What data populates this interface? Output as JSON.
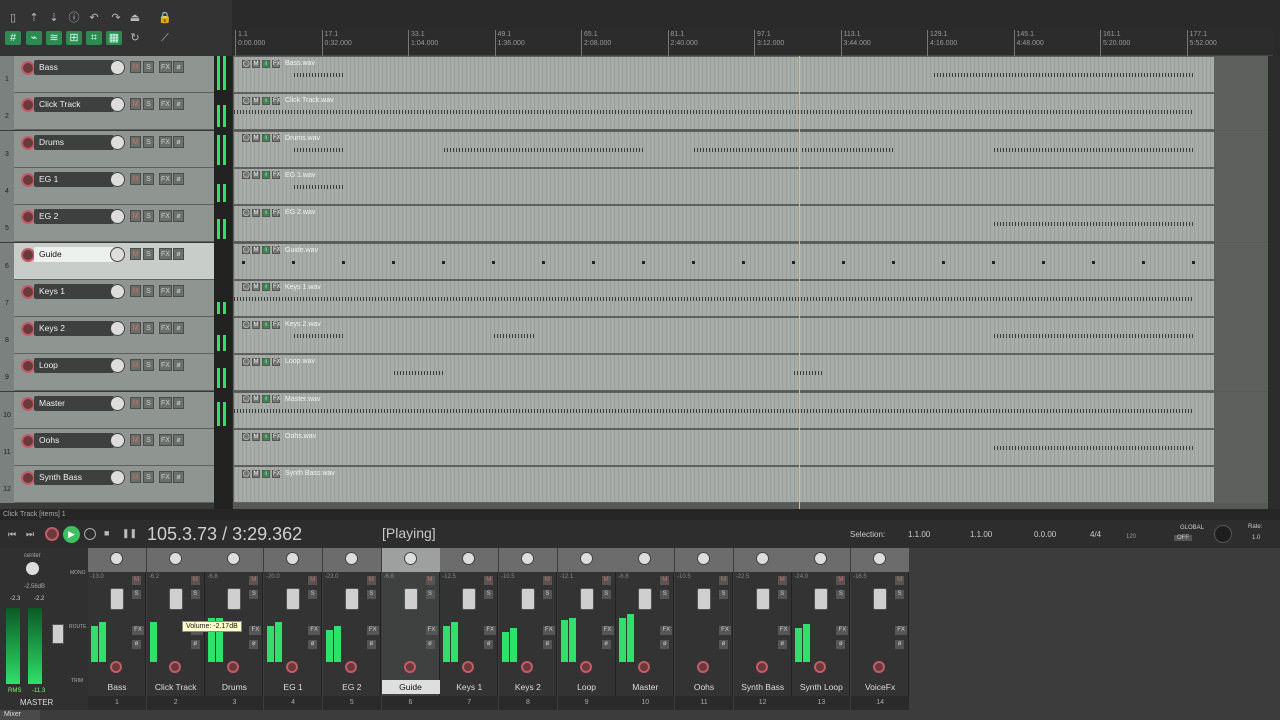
{
  "toolbar": {
    "icons": [
      "new-project-icon",
      "open-icon",
      "save-icon",
      "info-icon",
      "undo-icon",
      "redo-icon",
      "metronome-icon",
      "grid-icon",
      "snap-icon",
      "ripple-icon",
      "group-icon",
      "trim-icon",
      "grid-toggle-icon",
      "loop-icon",
      "lock-icon",
      "envelope-icon"
    ]
  },
  "ruler": {
    "marks": [
      {
        "bar": "1.1",
        "time": "0:00.000"
      },
      {
        "bar": "17.1",
        "time": "0:32.000"
      },
      {
        "bar": "33.1",
        "time": "1:04.000"
      },
      {
        "bar": "49.1",
        "time": "1:36.000"
      },
      {
        "bar": "65.1",
        "time": "2:08.000"
      },
      {
        "bar": "81.1",
        "time": "2:40.000"
      },
      {
        "bar": "97.1",
        "time": "3:12.000"
      },
      {
        "bar": "113.1",
        "time": "3:44.000"
      },
      {
        "bar": "129.1",
        "time": "4:16.000"
      },
      {
        "bar": "145.1",
        "time": "4:48.000"
      },
      {
        "bar": "161.1",
        "time": "5:20.000"
      },
      {
        "bar": "177.1",
        "time": "5:52.000"
      }
    ]
  },
  "tracks": [
    {
      "num": "1",
      "name": "Bass",
      "item": "Bass.wav"
    },
    {
      "num": "2",
      "name": "Click Track",
      "item": "Click Track.wav"
    },
    {
      "num": "3",
      "name": "Drums",
      "item": "Drums.wav"
    },
    {
      "num": "4",
      "name": "EG 1",
      "item": "EG 1.wav"
    },
    {
      "num": "5",
      "name": "EG 2",
      "item": "EG 2.wav"
    },
    {
      "num": "6",
      "name": "Guide",
      "item": "Guide.wav"
    },
    {
      "num": "7",
      "name": "Keys 1",
      "item": "Keys 1.wav"
    },
    {
      "num": "8",
      "name": "Keys 2",
      "item": "Keys 2.wav"
    },
    {
      "num": "9",
      "name": "Loop",
      "item": "Loop.wav"
    },
    {
      "num": "10",
      "name": "Master",
      "item": "Master.wav"
    },
    {
      "num": "11",
      "name": "Oohs",
      "item": "Oohs.wav"
    },
    {
      "num": "12",
      "name": "Synth Bass",
      "item": "Synth Bass.wav"
    }
  ],
  "track_buttons": {
    "mute": "M",
    "solo": "S",
    "fx": "FX",
    "phase": "ø"
  },
  "status_line": "Click Track [items] 1",
  "transport": {
    "position": "105.3.73 / 3:29.362",
    "state": "[Playing]",
    "selection_label": "Selection:",
    "sel_start": "1.1.00",
    "sel_end": "1.1.00",
    "sel_len": "0.0.00",
    "time_sig": "4/4",
    "bpm": "120",
    "global_label": "GLOBAL",
    "global_state": "OFF",
    "rate_label": "Rate:",
    "rate": "1.0"
  },
  "master": {
    "pan": "center",
    "db": "-2.56dB",
    "left": "-2.3",
    "right": "-2.2",
    "rms_label": "RMS",
    "rms": "-11.3",
    "name": "MASTER",
    "mono": "MONO",
    "route": "ROUTE",
    "trim": "TRIM"
  },
  "mixer_strips": [
    {
      "name": "Bass",
      "num": "1",
      "db": "-13.0"
    },
    {
      "name": "Click Track",
      "num": "2",
      "db": "-6.2"
    },
    {
      "name": "Drums",
      "num": "3",
      "db": "-6.8"
    },
    {
      "name": "EG 1",
      "num": "4",
      "db": "-20.0"
    },
    {
      "name": "EG 2",
      "num": "5",
      "db": "-23.0"
    },
    {
      "name": "Guide",
      "num": "6",
      "db": "-6.8"
    },
    {
      "name": "Keys 1",
      "num": "7",
      "db": "-12.5"
    },
    {
      "name": "Keys 2",
      "num": "8",
      "db": "-10.5"
    },
    {
      "name": "Loop",
      "num": "9",
      "db": "-12.1"
    },
    {
      "name": "Master",
      "num": "10",
      "db": "-6.8"
    },
    {
      "name": "Oohs",
      "num": "11",
      "db": "-10.5"
    },
    {
      "name": "Synth Bass",
      "num": "12",
      "db": "-22.5"
    },
    {
      "name": "Synth Loop",
      "num": "13",
      "db": "-24.0"
    },
    {
      "name": "VoiceFx",
      "num": "14",
      "db": "-16.5"
    }
  ],
  "tooltip": "Volume: -2.17dB",
  "mixer_tab": "Mixer"
}
